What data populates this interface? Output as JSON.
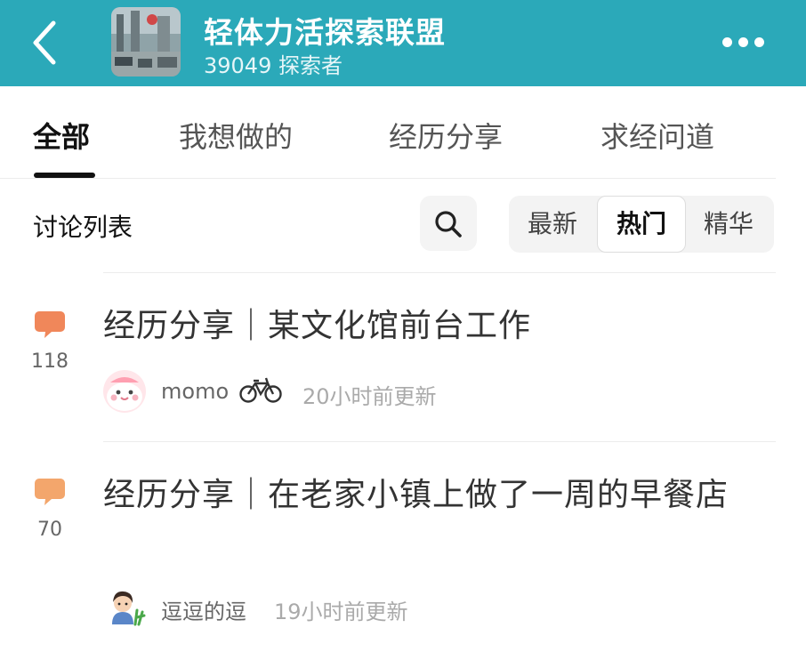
{
  "header": {
    "title": "轻体力活探索联盟",
    "members": "39049 探索者",
    "back_icon": "chevron-left-icon",
    "more_icon": "more-dots-icon",
    "background_color": "#2ba9b9"
  },
  "tabs": [
    {
      "label": "全部",
      "active": true
    },
    {
      "label": "我想做的",
      "active": false
    },
    {
      "label": "经历分享",
      "active": false
    },
    {
      "label": "求经问道",
      "active": false
    }
  ],
  "toolbar": {
    "heading": "讨论列表",
    "search_icon": "search-icon",
    "sort_options": [
      {
        "label": "最新",
        "active": false
      },
      {
        "label": "热门",
        "active": true
      },
      {
        "label": "精华",
        "active": false
      }
    ]
  },
  "posts": [
    {
      "comment_count": "118",
      "title": "经历分享｜某文化馆前台工作",
      "author": "momo",
      "author_badge_icon": "bicycle-icon",
      "updated": "20小时前更新",
      "comment_icon_color": "#f0875a"
    },
    {
      "comment_count": "70",
      "title": "经历分享｜在老家小镇上做了一周的早餐店",
      "author": "逗逗的逗",
      "updated": "19小时前更新",
      "comment_icon_color": "#f3a66c"
    }
  ]
}
